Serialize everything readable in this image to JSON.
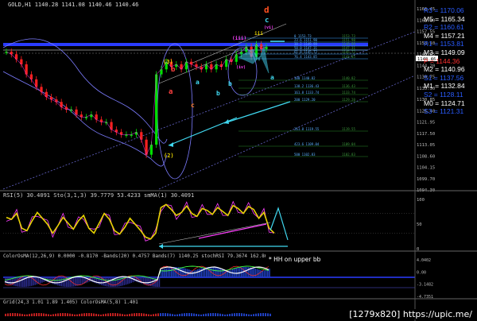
{
  "chart_title": "GOLD,H1  1140.28 1141.08 1140.46 1140.46",
  "price_tag": "1140.46",
  "footer": "[1279x820] https://upic.me/",
  "note": "* HH on upper bb",
  "rsi_header": "RSI(5) 30.4091  Sto(3,1,3) 39.7779 53.4233  smMA(1) 30.4091",
  "osc_header": "ColorOsMA(12,26,9) 0.0000 -0.8170  -Bands(20) 0.4757  Bands(7) 1140.25  stochRSI 79.3674 162.8626  Bands(7) 1140.2407  Bands(7) 1140.2407  OsMA(7) 1140.2407",
  "bottom_header": "Grid(24,3 1.01 1.89 1.405)  ColorOsMA(5,8) 1.401",
  "colors": {
    "candle_up": "#00e000",
    "candle_down": "#ff2020",
    "gold": "#e6d200",
    "cyan": "#40d8f0",
    "magenta": "#ff40ff",
    "hline": "#2a3cff"
  },
  "price_axis": [
    "1166.45",
    "1162.00",
    "1157.55",
    "1153.10",
    "1148.65",
    "1144.20",
    "1139.75",
    "1135.30",
    "1130.85",
    "1126.40",
    "1121.95",
    "1117.50",
    "1113.05",
    "1108.60",
    "1104.15",
    "1099.70",
    "1094.30"
  ],
  "rsi_axis": [
    "100",
    "50",
    "0"
  ],
  "osc_axis": [
    "4.0402",
    "0.00",
    "-3.1482",
    "-4.7351"
  ],
  "pivots": [
    {
      "label": "R3 = 1170.06",
      "color": "#2a5cff"
    },
    {
      "label": "M5 = 1165.34",
      "color": "#ffffff"
    },
    {
      "label": "R2 = 1160.61",
      "color": "#2a5cff"
    },
    {
      "label": "M4 = 1157.21",
      "color": "#ffffff"
    },
    {
      "label": "R1 = 1153.81",
      "color": "#2a5cff"
    },
    {
      "label": "M3 = 1149.09",
      "color": "#ffffff"
    },
    {
      "label": "P = 1144.36",
      "color": "#ff3030"
    },
    {
      "label": "M2 = 1140.96",
      "color": "#ffffff"
    },
    {
      "label": "S1 = 1137.56",
      "color": "#2a5cff"
    },
    {
      "label": "M1 = 1132.84",
      "color": "#ffffff"
    },
    {
      "label": "S2 = 1128.11",
      "color": "#2a5cff"
    },
    {
      "label": "M0 = 1124.71",
      "color": "#ffffff"
    },
    {
      "label": "S3 = 1121.31",
      "color": "#2a5cff"
    }
  ],
  "wave_labels": [
    {
      "text": "(3)",
      "color": "#e6d200"
    },
    {
      "text": "b",
      "color": "#ff4040"
    },
    {
      "text": "a",
      "color": "#ff4040"
    },
    {
      "text": "c",
      "color": "#ff8030"
    },
    {
      "text": "a",
      "color": "#40d8f0"
    },
    {
      "text": "b",
      "color": "#40d8f0"
    },
    {
      "text": "(2)",
      "color": "#e6d200"
    },
    {
      "text": "(iii)",
      "color": "#ff40ff"
    },
    {
      "text": "(iv)",
      "color": "#ff40ff"
    },
    {
      "text": "d",
      "color": "#ff5020"
    },
    {
      "text": "c",
      "color": "#40d8f0"
    },
    {
      "text": "(vi)",
      "color": "#ff40ff"
    },
    {
      "text": "a",
      "color": "#40d8f0"
    },
    {
      "text": "b",
      "color": "#40d8f0"
    },
    {
      "text": "iii",
      "color": "#e6d200"
    }
  ],
  "fib_labels": [
    "0 1153.73",
    "23.6 1151.90",
    "38.2 1149.99",
    "50.0 1147.31",
    "61.8 1145.72",
    "76.4 1143.85",
    "100 1140.82",
    "138.2 1136.43",
    "161.8 1133.74",
    "200 1129.20",
    "261.8 1119.55",
    "423.6 1109.04",
    "500 1102.83"
  ],
  "chart_data": [
    {
      "type": "line",
      "title": "GOLD,H1",
      "series": [
        {
          "name": "",
          "values": [
            1149,
            1148,
            1146,
            1144,
            1140,
            1138,
            1135,
            1133,
            1131,
            1130,
            1129,
            1127,
            1126,
            1126,
            1124,
            1123,
            1123,
            1124,
            1122,
            1121,
            1121,
            1118,
            1117,
            1116,
            1116,
            1116,
            1117,
            1114,
            1108,
            1112,
            1140,
            1142,
            1145,
            1143,
            1144,
            1142,
            1145,
            1144,
            1143,
            1142,
            1144,
            1142,
            1144,
            1143,
            1146,
            1145,
            1148,
            1149,
            1151,
            1147,
            1152,
            1150,
            1151
          ]
        }
      ],
      "ylim": [
        1094.3,
        1166.45
      ]
    },
    {
      "type": "line",
      "series": [
        {
          "name": "",
          "values": [
            62,
            58,
            70,
            40,
            35,
            55,
            72,
            60,
            48,
            30,
            45,
            62,
            50,
            38,
            55,
            66,
            40,
            30,
            50,
            70,
            58,
            35,
            28,
            42,
            60,
            48,
            36,
            22,
            18,
            30,
            82,
            88,
            78,
            66,
            72,
            85,
            70,
            64,
            80,
            76,
            68,
            82,
            74,
            66,
            86,
            80,
            70,
            84,
            78,
            60,
            72,
            40,
            30
          ]
        }
      ],
      "ylim": [
        0,
        100
      ]
    }
  ]
}
